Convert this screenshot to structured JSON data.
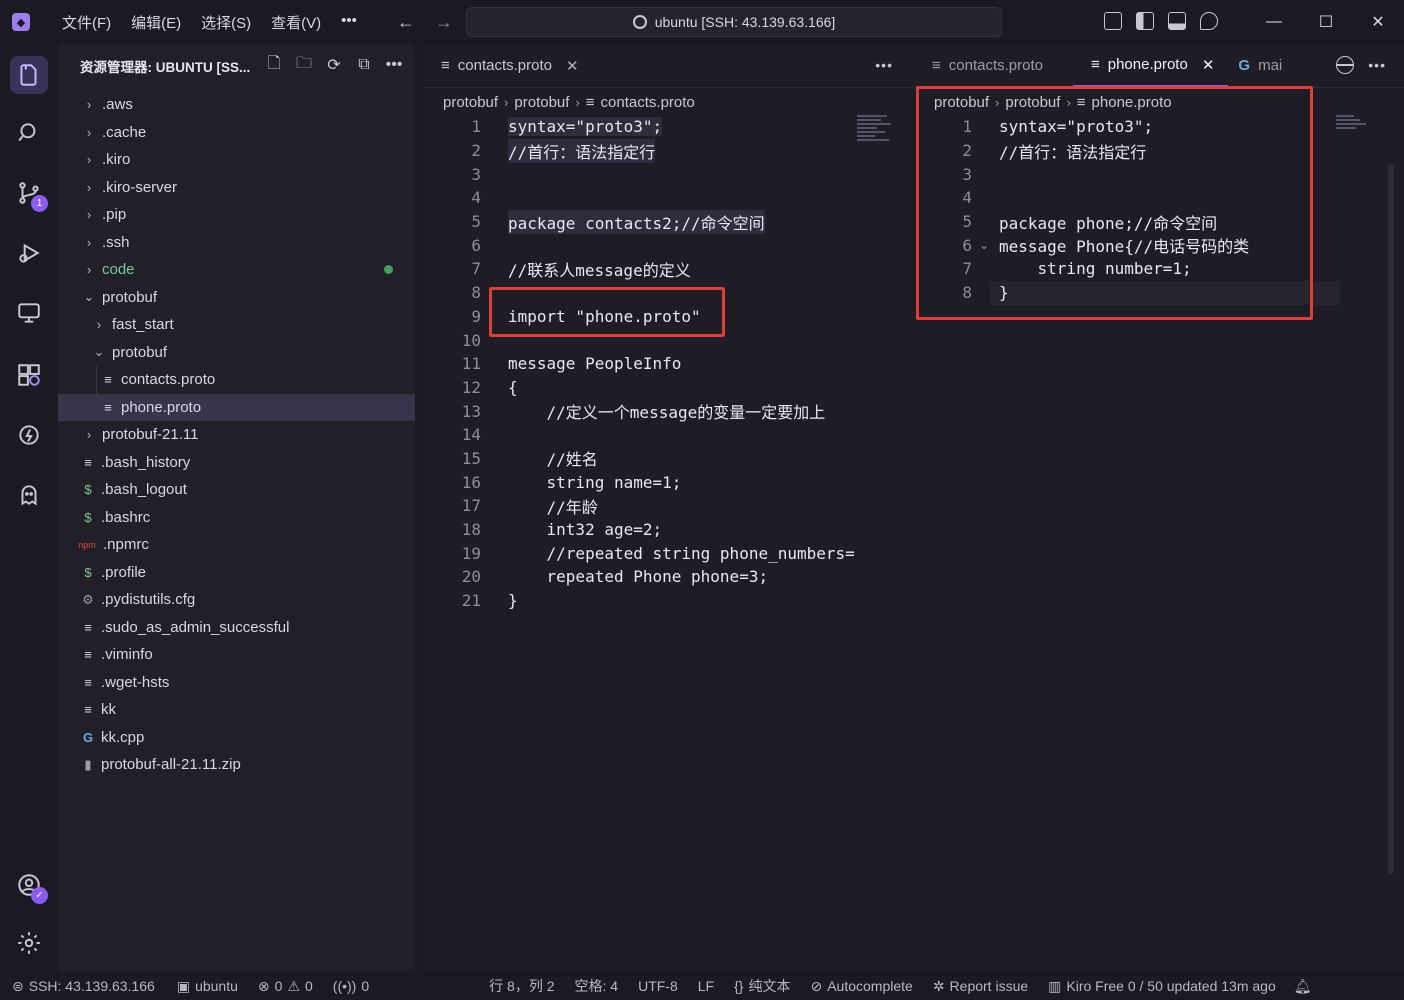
{
  "titlebar": {
    "menu": [
      "文件(F)",
      "编辑(E)",
      "选择(S)",
      "查看(V)"
    ],
    "more": "•••",
    "search_text": "ubuntu [SSH: 43.139.63.166]"
  },
  "sidebar": {
    "title": "资源管理器: UBUNTU [SS...",
    "items": [
      {
        "label": ".aws",
        "type": "folder"
      },
      {
        "label": ".cache",
        "type": "folder"
      },
      {
        "label": ".kiro",
        "type": "folder"
      },
      {
        "label": ".kiro-server",
        "type": "folder"
      },
      {
        "label": ".pip",
        "type": "folder"
      },
      {
        "label": ".ssh",
        "type": "folder"
      },
      {
        "label": "code",
        "type": "folder"
      },
      {
        "label": "protobuf",
        "type": "folder-open"
      },
      {
        "label": "fast_start",
        "type": "folder"
      },
      {
        "label": "protobuf",
        "type": "folder-open"
      },
      {
        "label": "contacts.proto",
        "type": "file"
      },
      {
        "label": "phone.proto",
        "type": "file"
      },
      {
        "label": "protobuf-21.11",
        "type": "folder"
      },
      {
        "label": ".bash_history",
        "type": "file"
      },
      {
        "label": ".bash_logout",
        "type": "shell"
      },
      {
        "label": ".bashrc",
        "type": "shell"
      },
      {
        "label": ".npmrc",
        "type": "npm"
      },
      {
        "label": ".profile",
        "type": "shell"
      },
      {
        "label": ".pydistutils.cfg",
        "type": "gear"
      },
      {
        "label": ".sudo_as_admin_successful",
        "type": "file"
      },
      {
        "label": ".viminfo",
        "type": "file"
      },
      {
        "label": ".wget-hsts",
        "type": "file"
      },
      {
        "label": "kk",
        "type": "file"
      },
      {
        "label": "kk.cpp",
        "type": "cpp"
      },
      {
        "label": "protobuf-all-21.11.zip",
        "type": "zip"
      }
    ]
  },
  "editor_left": {
    "tab": "contacts.proto",
    "breadcrumb": [
      "protobuf",
      "protobuf",
      "contacts.proto"
    ],
    "lines": [
      {
        "n": "1",
        "text": "syntax=\"proto3\";"
      },
      {
        "n": "2",
        "text": "//首行：语法指定行"
      },
      {
        "n": "3",
        "text": ""
      },
      {
        "n": "4",
        "text": ""
      },
      {
        "n": "5",
        "text": "package contacts2;//命令空间"
      },
      {
        "n": "6",
        "text": ""
      },
      {
        "n": "7",
        "text": "//联系人message的定义"
      },
      {
        "n": "8",
        "text": ""
      },
      {
        "n": "9",
        "text": "import \"phone.proto\""
      },
      {
        "n": "10",
        "text": ""
      },
      {
        "n": "11",
        "text": "message PeopleInfo"
      },
      {
        "n": "12",
        "text": "{"
      },
      {
        "n": "13",
        "text": "    //定义一个message的变量一定要加上"
      },
      {
        "n": "14",
        "text": ""
      },
      {
        "n": "15",
        "text": "    //姓名"
      },
      {
        "n": "16",
        "text": "    string name=1;"
      },
      {
        "n": "17",
        "text": "    //年龄"
      },
      {
        "n": "18",
        "text": "    int32 age=2;"
      },
      {
        "n": "19",
        "text": "    //repeated string phone_numbers="
      },
      {
        "n": "20",
        "text": "    repeated Phone phone=3;"
      },
      {
        "n": "21",
        "text": "}"
      }
    ]
  },
  "editor_right": {
    "tabs": [
      "contacts.proto",
      "phone.proto",
      "mai"
    ],
    "breadcrumb": [
      "protobuf",
      "protobuf",
      "phone.proto"
    ],
    "lines": [
      {
        "n": "1",
        "text": "syntax=\"proto3\";"
      },
      {
        "n": "2",
        "text": "//首行：语法指定行"
      },
      {
        "n": "3",
        "text": ""
      },
      {
        "n": "4",
        "text": ""
      },
      {
        "n": "5",
        "text": "package phone;//命令空间"
      },
      {
        "n": "6",
        "text": "message Phone{//电话号码的类"
      },
      {
        "n": "7",
        "text": "    string number=1;"
      },
      {
        "n": "8",
        "text": "}"
      }
    ]
  },
  "statusbar": {
    "ssh": "SSH: 43.139.63.166",
    "workspace": "ubuntu",
    "errors": "0",
    "warnings": "0",
    "ports": "0",
    "position": "行 8，列 2",
    "spaces": "空格: 4",
    "encoding": "UTF-8",
    "eol": "LF",
    "language": "纯文本",
    "autocomplete": "Autocomplete",
    "report": "Report issue",
    "kiro": "Kiro Free 0 / 50 updated 13m ago"
  },
  "colors": {
    "accent": "#8a5cf6",
    "highlight_box": "#e23b3b",
    "modified_dot": "#3da35a"
  }
}
